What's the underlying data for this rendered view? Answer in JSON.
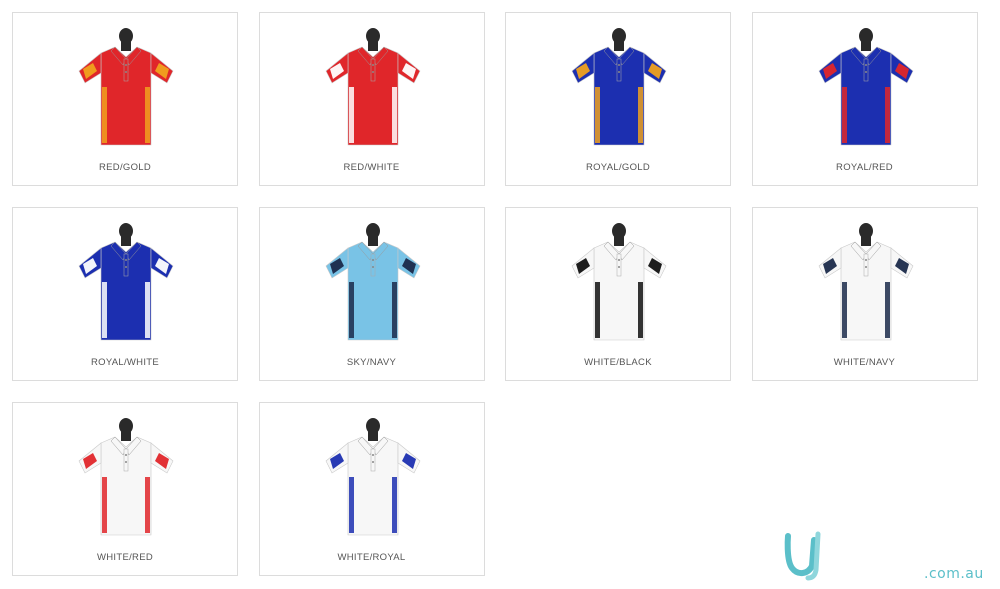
{
  "products": [
    {
      "label": "RED/GOLD",
      "body": "#e0262a",
      "accent": "#f0a11e",
      "collar": "#e0262a"
    },
    {
      "label": "RED/WHITE",
      "body": "#e0262a",
      "accent": "#ffffff",
      "collar": "#e0262a"
    },
    {
      "label": "ROYAL/GOLD",
      "body": "#1c2fb0",
      "accent": "#f0a11e",
      "collar": "#1c2fb0"
    },
    {
      "label": "ROYAL/RED",
      "body": "#1c2fb0",
      "accent": "#e0262a",
      "collar": "#1c2fb0"
    },
    {
      "label": "ROYAL/WHITE",
      "body": "#1c2fb0",
      "accent": "#ffffff",
      "collar": "#1c2fb0"
    },
    {
      "label": "SKY/NAVY",
      "body": "#79c3e6",
      "accent": "#1b2a4a",
      "collar": "#79c3e6"
    },
    {
      "label": "WHITE/BLACK",
      "body": "#f7f7f7",
      "accent": "#111111",
      "collar": "#f7f7f7"
    },
    {
      "label": "WHITE/NAVY",
      "body": "#f7f7f7",
      "accent": "#1b2a4a",
      "collar": "#f7f7f7"
    },
    {
      "label": "WHITE/RED",
      "body": "#f7f7f7",
      "accent": "#e0262a",
      "collar": "#f7f7f7"
    },
    {
      "label": "WHITE/ROYAL",
      "body": "#f7f7f7",
      "accent": "#1c2fb0",
      "collar": "#f7f7f7"
    }
  ],
  "branding": {
    "domain": ".com.au",
    "logo_icon": "u-logo-icon",
    "logo_color": "#5bbfc9"
  }
}
